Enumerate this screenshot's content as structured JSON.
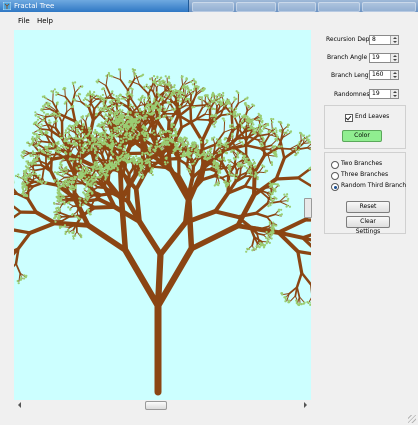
{
  "window": {
    "title": "Fractal Tree"
  },
  "menu": {
    "file": "File",
    "help": "Help"
  },
  "controls": {
    "recursion_depth": {
      "label": "Recursion Depth:",
      "value": "8"
    },
    "branch_angle": {
      "label": "Branch Angle (°):",
      "value": "19"
    },
    "branch_length": {
      "label": "Branch Length:",
      "value": "160"
    },
    "randomness": {
      "label": "Randomness:",
      "value": "19"
    },
    "end_leaves": {
      "label": "End Leaves",
      "checked": true
    },
    "color_button": {
      "label": "Color",
      "color": "#90ee90"
    },
    "options": {
      "two_branches": {
        "label": "Two Branches",
        "selected": false
      },
      "three_branches": {
        "label": "Three Branches",
        "selected": false
      },
      "random_third": {
        "label": "Random Third Branch",
        "selected": true
      }
    },
    "reset": "Reset",
    "clear_settings": "Clear Settings"
  },
  "tree": {
    "trunk_color": "#8b4513",
    "leaf_color": "#9acd73",
    "background": "#ccffff"
  }
}
